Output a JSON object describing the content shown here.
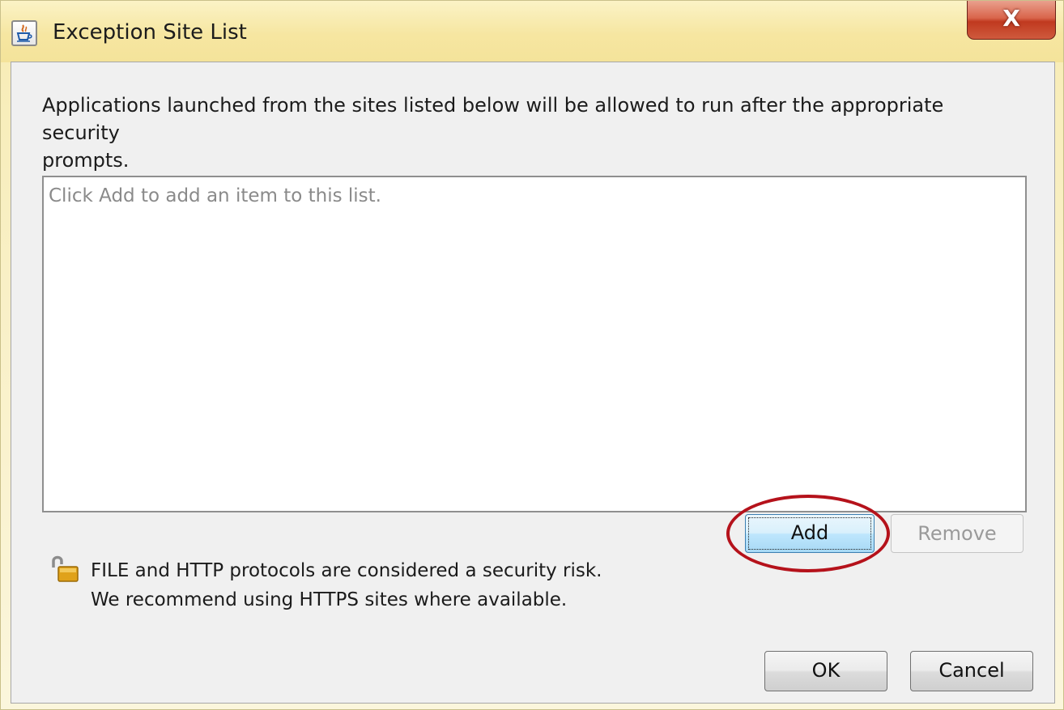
{
  "window": {
    "title": "Exception Site List",
    "close_label": "X"
  },
  "description": {
    "line1": "Applications launched from the sites listed below will be allowed to run after the appropriate security",
    "line2": "prompts."
  },
  "site_list": {
    "placeholder": "Click Add to add an item to this list."
  },
  "buttons": {
    "add_label": "Add",
    "remove_label": "Remove",
    "ok_label": "OK",
    "cancel_label": "Cancel"
  },
  "warning": {
    "line1": "FILE and HTTP protocols are considered a security risk.",
    "line2": "We recommend using HTTPS sites where available.",
    "icon": "unlocked-padlock-icon"
  },
  "colors": {
    "highlight_ring": "#b5121b",
    "close_button": "#c0391f",
    "title_bar": "#f6e6a1"
  }
}
